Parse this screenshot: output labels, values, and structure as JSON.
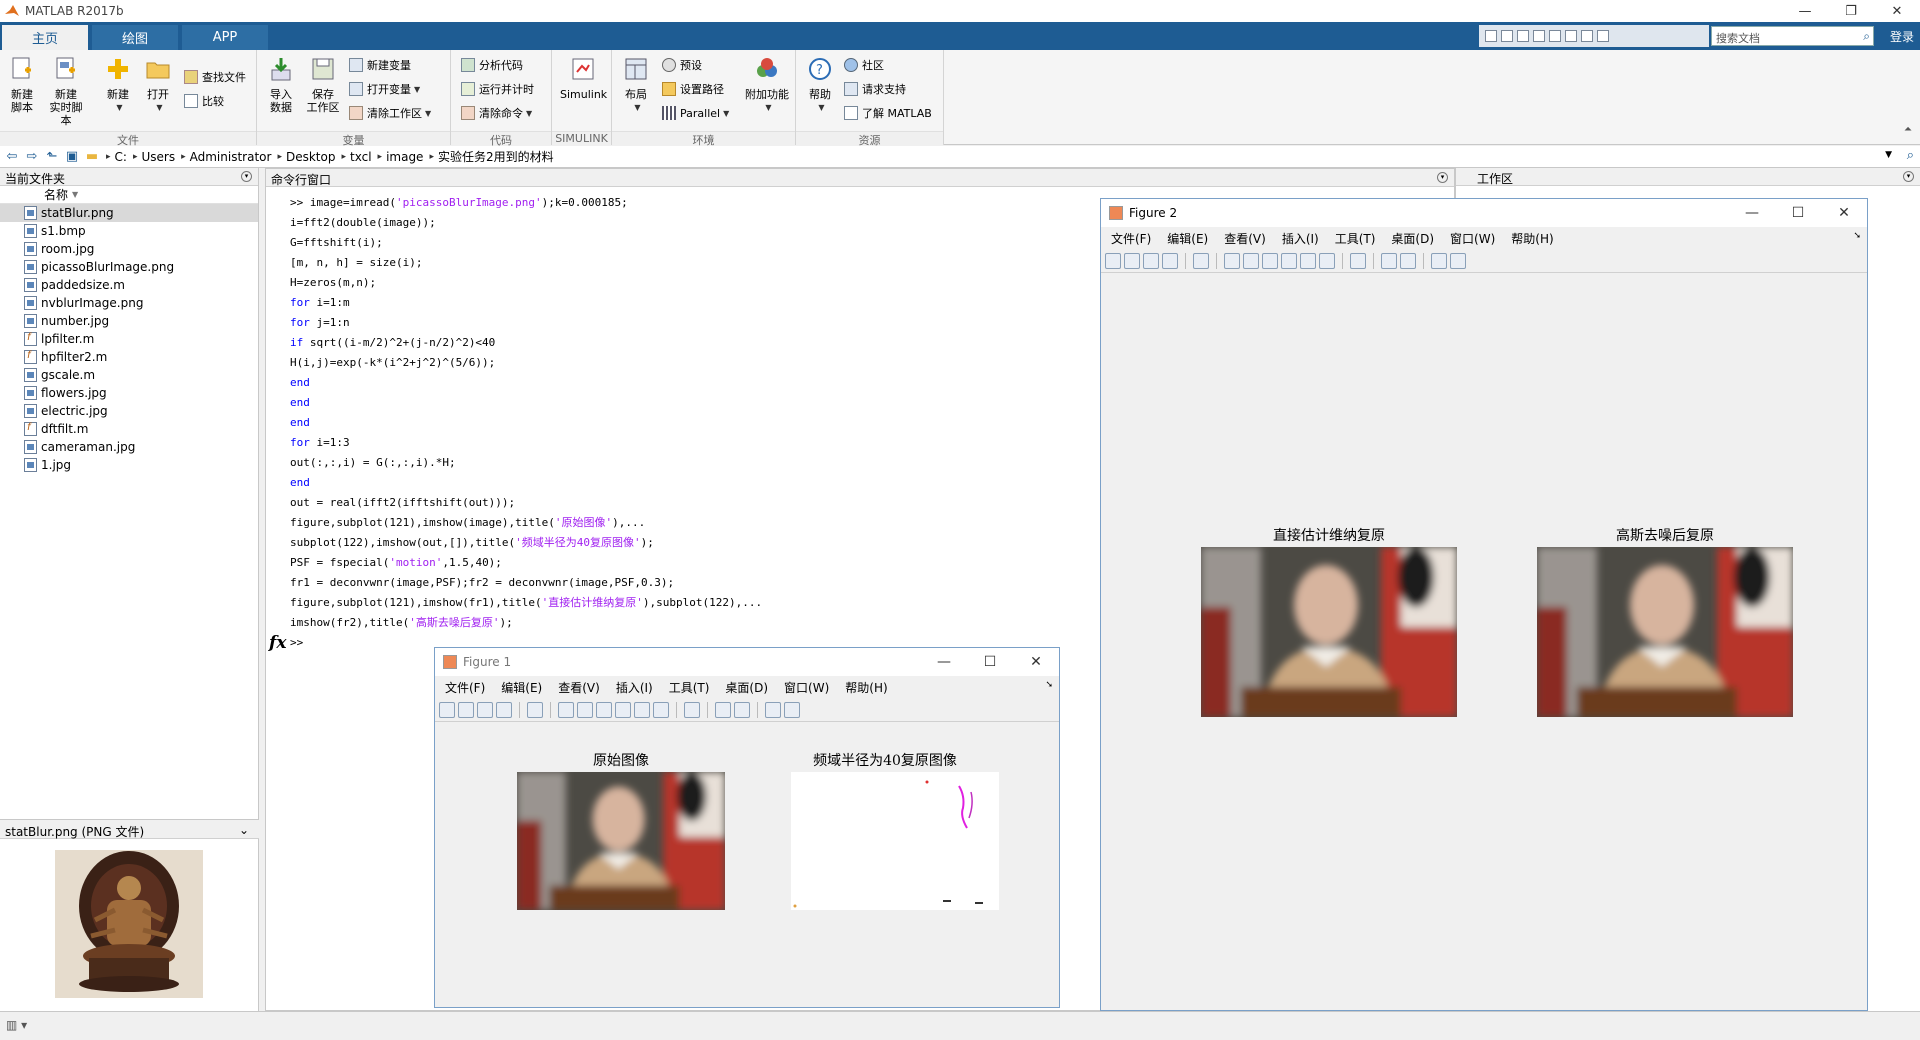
{
  "window": {
    "title": "MATLAB R2017b"
  },
  "tabs": [
    {
      "label": "主页"
    },
    {
      "label": "绘图"
    },
    {
      "label": "APP"
    }
  ],
  "search": {
    "placeholder": "搜索文档"
  },
  "login_label": "登录",
  "ribbon": {
    "file": {
      "label": "文件",
      "new_script": "新建\n脚本",
      "new_live_script": "新建\n实时脚本",
      "new": "新建",
      "open": "打开",
      "find_files": "查找文件",
      "compare": "比较"
    },
    "variable": {
      "label": "变量",
      "import_data": "导入\n数据",
      "save_workspace": "保存\n工作区",
      "new_variable": "新建变量",
      "open_variable": "打开变量",
      "clear_workspace": "清除工作区"
    },
    "code": {
      "label": "代码",
      "analyze_code": "分析代码",
      "run_and_time": "运行并计时",
      "clear_commands": "清除命令"
    },
    "simulink": {
      "label": "SIMULINK",
      "button": "Simulink"
    },
    "environment": {
      "label": "环境",
      "layout": "布局",
      "preferences": "预设",
      "set_path": "设置路径",
      "parallel": "Parallel",
      "addons": "附加功能"
    },
    "resources": {
      "label": "资源",
      "help": "帮助",
      "community": "社区",
      "request_support": "请求支持",
      "learn_matlab": "了解 MATLAB"
    }
  },
  "address": {
    "path": [
      "C:",
      "Users",
      "Administrator",
      "Desktop",
      "txcl",
      "image",
      "实验任务2用到的材料"
    ]
  },
  "current_folder": {
    "title": "当前文件夹",
    "column_name": "名称",
    "files": [
      {
        "name": "statBlur.png",
        "type": "img"
      },
      {
        "name": "s1.bmp",
        "type": "img"
      },
      {
        "name": "room.jpg",
        "type": "img"
      },
      {
        "name": "picassoBlurImage.png",
        "type": "img"
      },
      {
        "name": "paddedsize.m",
        "type": "img"
      },
      {
        "name": "nvblurImage.png",
        "type": "img"
      },
      {
        "name": "number.jpg",
        "type": "img"
      },
      {
        "name": "lpfilter.m",
        "type": "m"
      },
      {
        "name": "hpfilter2.m",
        "type": "m"
      },
      {
        "name": "gscale.m",
        "type": "img"
      },
      {
        "name": "flowers.jpg",
        "type": "img"
      },
      {
        "name": "electric.jpg",
        "type": "img"
      },
      {
        "name": "dftfilt.m",
        "type": "m"
      },
      {
        "name": "cameraman.jpg",
        "type": "img"
      },
      {
        "name": "1.jpg",
        "type": "img"
      }
    ],
    "detail_label": "statBlur.png  (PNG 文件)"
  },
  "command_window": {
    "title": "命令行窗口",
    "prompt": ">>"
  },
  "workspace": {
    "title": "工作区"
  },
  "figure1": {
    "title": "Figure 1",
    "menus": [
      "文件(F)",
      "编辑(E)",
      "查看(V)",
      "插入(I)",
      "工具(T)",
      "桌面(D)",
      "窗口(W)",
      "帮助(H)"
    ],
    "axes": [
      {
        "title": "原始图像"
      },
      {
        "title": "频域半径为40复原图像"
      }
    ]
  },
  "figure2": {
    "title": "Figure 2",
    "menus": [
      "文件(F)",
      "编辑(E)",
      "查看(V)",
      "插入(I)",
      "工具(T)",
      "桌面(D)",
      "窗口(W)",
      "帮助(H)"
    ],
    "axes": [
      {
        "title": "直接估计维纳复原"
      },
      {
        "title": "高斯去噪后复原"
      }
    ]
  },
  "colors": {
    "tabbar": "#1e5c93",
    "keyword": "#0000ff",
    "string": "#a020f0"
  }
}
